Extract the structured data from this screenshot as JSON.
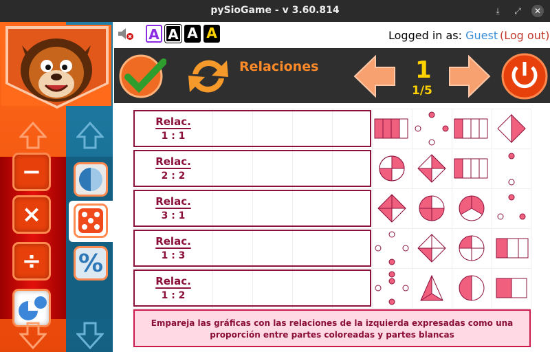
{
  "window": {
    "title": "pySioGame - v 3.60.814"
  },
  "topbar": {
    "font_sizes": [
      "A",
      "A",
      "A",
      "A"
    ],
    "logged_prefix": "Logged in as:",
    "user": "Guest",
    "logout": "(Log out)"
  },
  "header": {
    "title": "Relaciones",
    "level": "1",
    "progress": "1/5"
  },
  "relations": [
    {
      "label": "Relac.",
      "value": "1 : 1"
    },
    {
      "label": "Relac.",
      "value": "2 : 2"
    },
    {
      "label": "Relac.",
      "value": "3 : 1"
    },
    {
      "label": "Relac.",
      "value": "1 : 3"
    },
    {
      "label": "Relac.",
      "value": "1 : 2"
    }
  ],
  "instruction": "Empareja las gráficas con las relaciones de la izquierda expresadas como una proporción entre partes coloreadas y partes blancas",
  "colors": {
    "accent": "#ff6a1a",
    "maroon": "#8a0f3a",
    "pink": "#f0607e",
    "blue": "#1f7fa8"
  }
}
